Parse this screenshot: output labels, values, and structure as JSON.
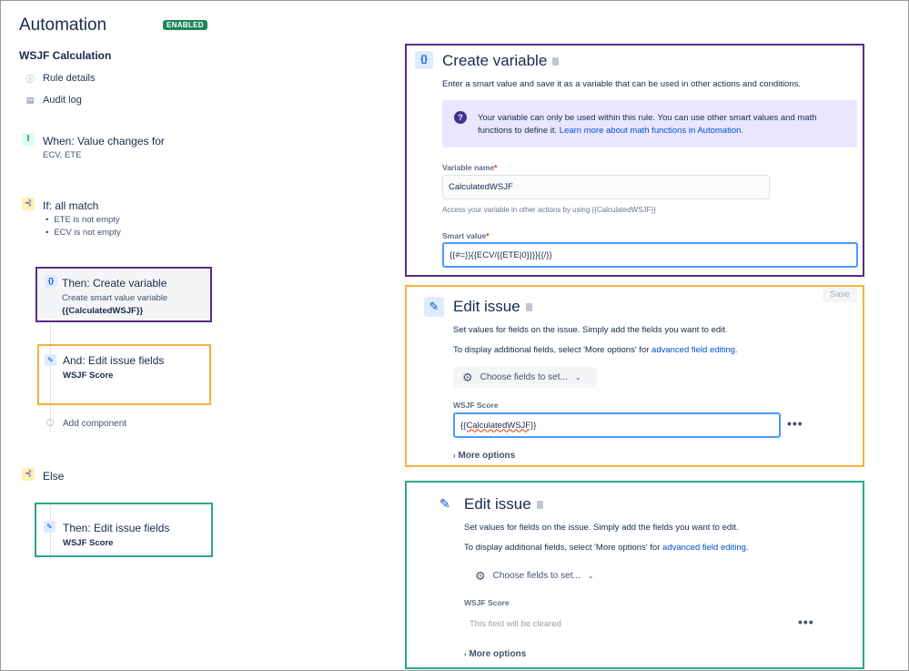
{
  "header": {
    "title": "Automation",
    "status_badge": "ENABLED"
  },
  "rule": {
    "name": "WSJF Calculation"
  },
  "nav": [
    {
      "label": "Rule details",
      "icon": "info-icon"
    },
    {
      "label": "Audit log",
      "icon": "document-icon"
    }
  ],
  "trigger": {
    "label": "When: Value changes for",
    "sub": "ECV, ETE",
    "icon": "trigger-icon"
  },
  "condition": {
    "label": "If: all match",
    "items": [
      "ETE is not empty",
      "ECV is not empty"
    ],
    "icon": "branch-icon"
  },
  "steps": {
    "create_var": {
      "label": "Then: Create variable",
      "sub": "Create smart value variable",
      "value": "{{CalculatedWSJF}}"
    },
    "edit_fields": {
      "label": "And: Edit issue fields",
      "value": "WSJF Score"
    },
    "add_component": "Add component",
    "else_label": "Else",
    "else_edit": {
      "label": "Then: Edit issue fields",
      "value": "WSJF Score"
    }
  },
  "create_variable_panel": {
    "icon_text": "{}",
    "title": "Create variable",
    "description": "Enter a smart value and save it as a variable that can be used in other actions and conditions.",
    "info_text": "Your variable can only be used within this rule. You can use other smart values and math functions to define it.",
    "info_link": "Learn more about math functions in Automation.",
    "name_label": "Variable name",
    "name_value": "CalculatedWSJF",
    "name_help": "Access your variable in other actions by using {{CalculatedWSJF}}",
    "smart_label": "Smart value",
    "smart_value": "{{#=}}{{ECV/{{ETE|0}}}}{{/}}"
  },
  "edit_issue_panel_1": {
    "title": "Edit issue",
    "save_label": "Save",
    "description": "Set values for fields on the issue. Simply add the fields you want to edit.",
    "extra_text": "To display additional fields, select 'More options' for",
    "extra_link": "advanced field editing.",
    "choose_label": "Choose fields to set...",
    "field_label": "WSJF Score",
    "field_value": "{{CalculatedWSJF}}",
    "more_options": "More options"
  },
  "edit_issue_panel_2": {
    "title": "Edit issue",
    "description": "Set values for fields on the issue. Simply add the fields you want to edit.",
    "extra_text": "To display additional fields, select 'More options' for",
    "extra_link": "advanced field editing.",
    "choose_label": "Choose fields to set...",
    "field_label": "WSJF Score",
    "field_placeholder": "This field will be cleared",
    "more_options": "More options"
  },
  "colors": {
    "highlight_purple": "#5b2c83",
    "highlight_orange": "#f0b33c",
    "highlight_green": "#2ea58a",
    "link": "#0052cc",
    "enabled": "#1f845a"
  }
}
